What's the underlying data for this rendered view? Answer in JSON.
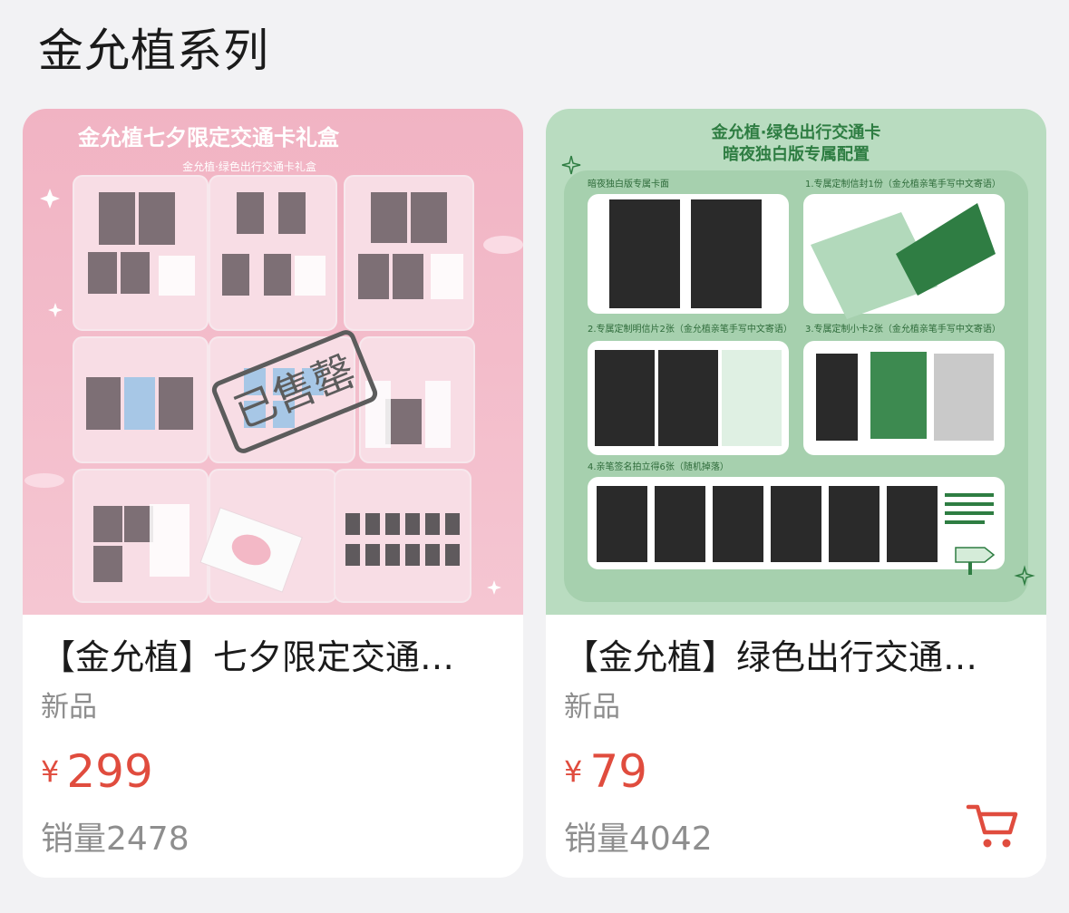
{
  "section": {
    "title": "金允植系列"
  },
  "products": [
    {
      "name": "【金允植】七夕限定交通…",
      "tag": "新品",
      "currency": "¥",
      "price": "299",
      "sales": "销量2478",
      "image": {
        "title": "金允植七夕限定交通卡礼盒",
        "subtitle": "金允植·绿色出行交通卡礼盒",
        "stamp": "已售罄"
      }
    },
    {
      "name": "【金允植】绿色出行交通…",
      "tag": "新品",
      "currency": "¥",
      "price": "79",
      "sales": "销量4042",
      "image": {
        "title_line1": "金允植·绿色出行交通卡",
        "title_line2": "暗夜独白版专属配置",
        "panel1": "暗夜独白版专属卡面",
        "panel2": "1.专属定制信封1份（金允植亲笔手写中文寄语）",
        "panel3": "2.专属定制明信片2张（金允植亲笔手写中文寄语）",
        "panel4": "3.专属定制小卡2张（金允植亲笔手写中文寄语）",
        "panel5": "4.亲笔签名拍立得6张（随机掉落）"
      },
      "cart_icon": "cart-icon"
    }
  ],
  "colors": {
    "price": "#e04c3e",
    "muted": "#8e8e8e",
    "pink": "#f2b9c7",
    "green": "#b9dcc0"
  }
}
